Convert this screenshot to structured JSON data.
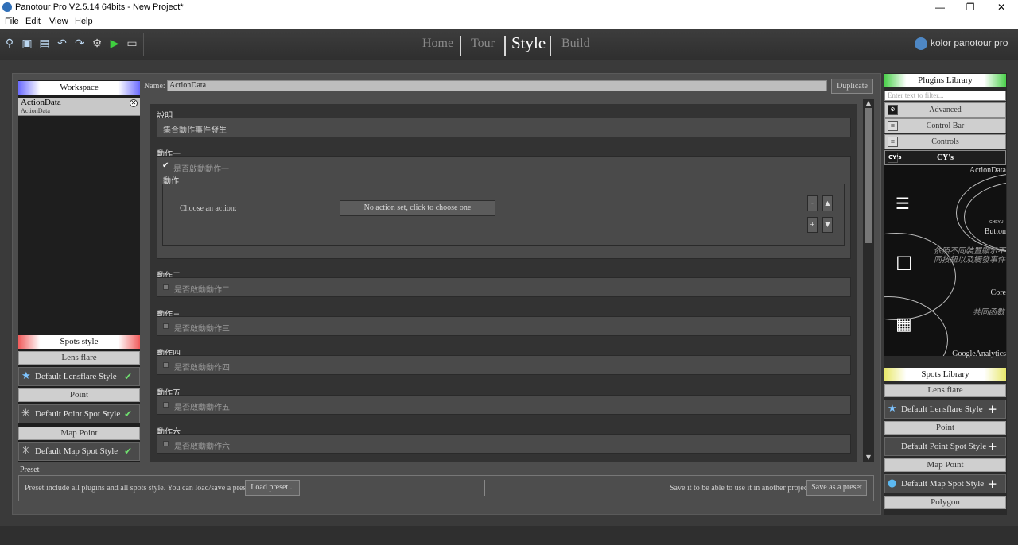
{
  "window": {
    "title": "Panotour Pro V2.5.14 64bits - New Project*",
    "minimize": "—",
    "maximize": "❐",
    "close": "✕"
  },
  "menu": [
    "File",
    "Edit",
    "View",
    "Help"
  ],
  "toolbar": {
    "icons": [
      "open-project-icon",
      "save-icon",
      "add-panorama-icon",
      "undo-icon",
      "redo-icon",
      "settings-icon",
      "play-icon",
      "preview-icon"
    ],
    "tabs": [
      "Home",
      "Tour",
      "Style",
      "Build"
    ],
    "active_tab": "Style",
    "brand": "kolor panotour pro"
  },
  "workspace": {
    "header": "Workspace",
    "item_name": "ActionData",
    "item_sub": "ActionData"
  },
  "spots_style": {
    "header": "Spots style",
    "groups": [
      {
        "group": "Lens flare",
        "item": "Default Lensflare Style"
      },
      {
        "group": "Point",
        "item": "Default Point Spot Style"
      },
      {
        "group": "Map Point",
        "item": "Default Map Spot Style"
      }
    ]
  },
  "editor": {
    "name_label": "Name:",
    "name_value": "ActionData",
    "duplicate": "Duplicate",
    "desc_header": "說明",
    "desc_value": "集合動作事件發生",
    "action1_header": "動作一",
    "action1_enable": "是否啟動動作一",
    "action_label": "動作",
    "choose_label": "Choose an action:",
    "choose_button": "No action set, click to choose one",
    "minus": "-",
    "plus": "+",
    "up": "▲",
    "down": "▼",
    "sections": [
      {
        "header": "動作二",
        "enable": "是否啟動動作二"
      },
      {
        "header": "動作三",
        "enable": "是否啟動動作三"
      },
      {
        "header": "動作四",
        "enable": "是否啟動動作四"
      },
      {
        "header": "動作五",
        "enable": "是否啟動動作五"
      },
      {
        "header": "動作六",
        "enable": "是否啟動動作六"
      }
    ]
  },
  "preset": {
    "label": "Preset",
    "info": "Preset include all plugins and all spots style. You can load/save a preset.",
    "load_button": "Load preset...",
    "save_info": "Save it to be able to use it in another project",
    "save_button": "Save as a preset"
  },
  "plugins": {
    "header": "Plugins Library",
    "filter_placeholder": "Enter text to filter...",
    "categories": [
      "Advanced",
      "Control Bar",
      "Controls",
      "CY's"
    ],
    "cys_badge": "CY's",
    "thumbs": [
      {
        "label": "ActionData",
        "caption": "CHEYU"
      },
      {
        "label": "Button",
        "caption": "依照不同裝置顯示不同按鈕以及觸發事件"
      },
      {
        "label": "Core",
        "caption": "共同函數"
      },
      {
        "label": "GoogleAnalytics",
        "caption": ""
      }
    ]
  },
  "spots_library": {
    "header": "Spots Library",
    "groups": [
      {
        "group": "Lens flare",
        "item": "Default Lensflare Style"
      },
      {
        "group": "Point",
        "item": "Default Point Spot Style"
      },
      {
        "group": "Map Point",
        "item": "Default Map Spot Style"
      },
      {
        "group": "Polygon",
        "item": ""
      }
    ]
  }
}
